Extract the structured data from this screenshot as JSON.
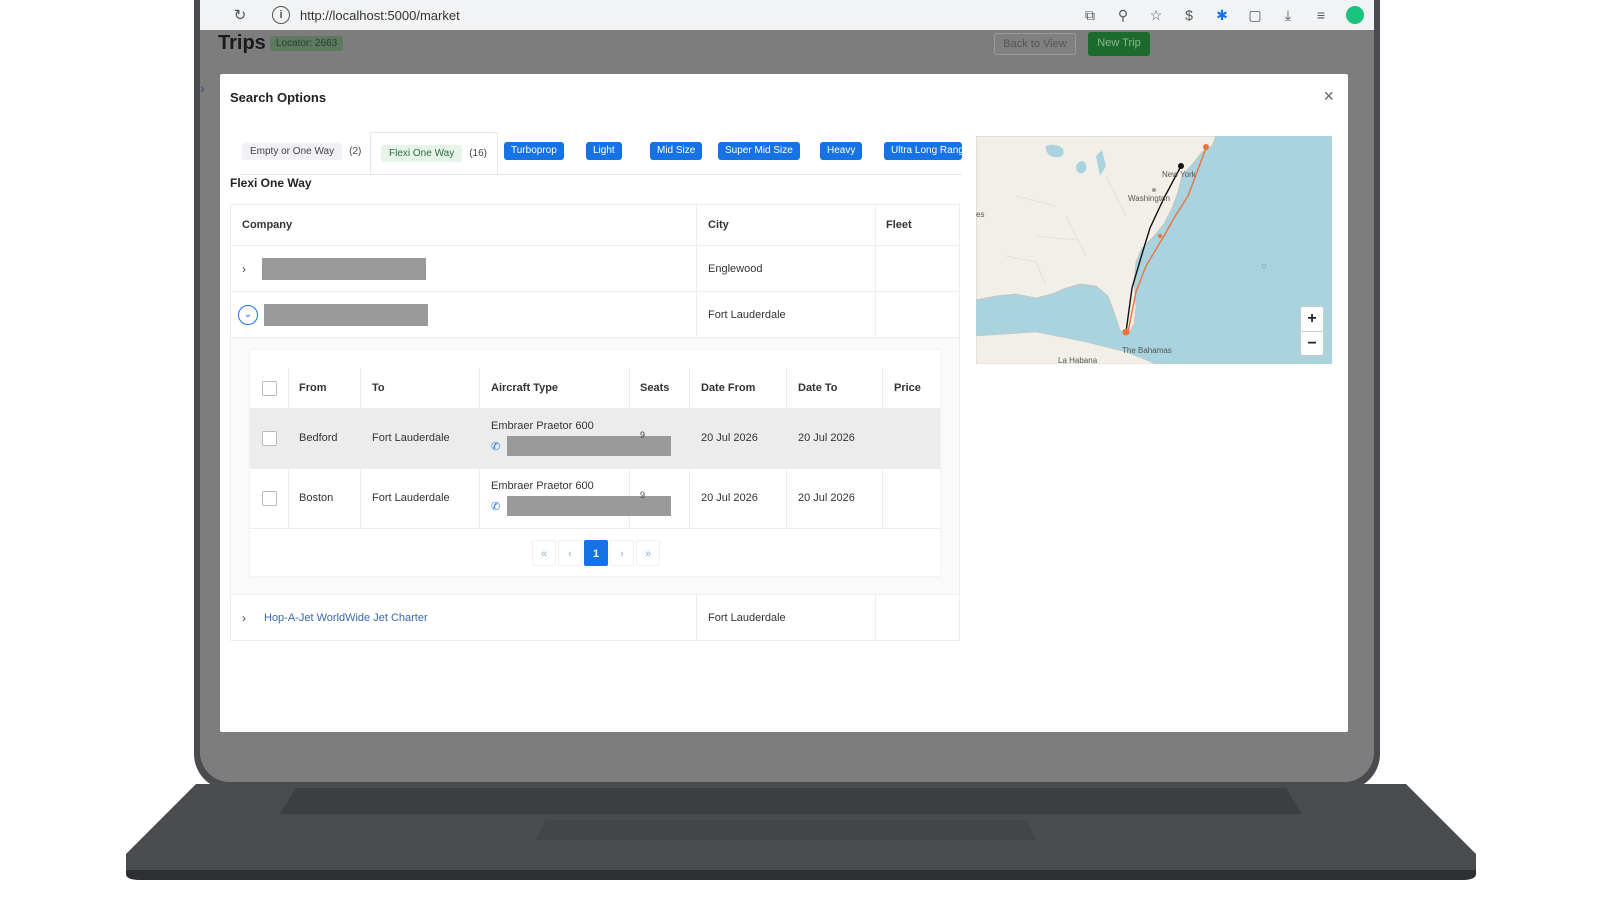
{
  "browser": {
    "url": "http://localhost:5000/market",
    "reload_icon": "reload-icon",
    "info_icon": "info-icon"
  },
  "app": {
    "title": "Trips",
    "locator": "Locator: 2663",
    "back_button": "Back to View",
    "new_trip_button": "New Trip"
  },
  "modal": {
    "title": "Search Options",
    "close_label": "×",
    "section_title": "Flexi One Way"
  },
  "tabs": [
    {
      "label": "Empty or One Way",
      "count": "(2)"
    },
    {
      "label": "Flexi One Way",
      "count": "(16)"
    }
  ],
  "filters": [
    "Turboprop",
    "Light",
    "Mid Size",
    "Super Mid Size",
    "Heavy",
    "Ultra Long Rang"
  ],
  "company_table": {
    "headers": {
      "company": "Company",
      "city": "City",
      "fleet": "Fleet"
    },
    "rows": [
      {
        "company": "",
        "city": "Englewood",
        "fleet": ""
      },
      {
        "company": "",
        "city": "Fort Lauderdale",
        "fleet": ""
      },
      {
        "company": "Hop-A-Jet WorldWide Jet Charter",
        "city": "Fort Lauderdale",
        "fleet": ""
      }
    ]
  },
  "flights_table": {
    "headers": {
      "from": "From",
      "to": "To",
      "aircraft": "Aircraft Type",
      "seats": "Seats",
      "date_from": "Date From",
      "date_to": "Date To",
      "price": "Price"
    },
    "rows": [
      {
        "from": "Bedford",
        "to": "Fort Lauderdale",
        "aircraft": "Embraer Praetor 600",
        "seats": "9",
        "date_from": "20 Jul 2026",
        "date_to": "20 Jul 2026",
        "price": ""
      },
      {
        "from": "Boston",
        "to": "Fort Lauderdale",
        "aircraft": "Embraer Praetor 600",
        "seats": "9",
        "date_from": "20 Jul 2026",
        "date_to": "20 Jul 2026",
        "price": ""
      }
    ]
  },
  "pagination": {
    "first": "«",
    "prev": "‹",
    "current": "1",
    "next": "›",
    "last": "»"
  },
  "map": {
    "labels": {
      "new_york": "New York",
      "washington": "Washington",
      "bahamas": "The Bahamas",
      "havana": "La Habana",
      "partial": "es"
    },
    "zoom_in": "+",
    "zoom_out": "−",
    "route_colors": {
      "route_a": "#111111",
      "route_b": "#e8753b"
    }
  },
  "colors": {
    "accent": "#1673e6",
    "success": "#1d6a2e"
  }
}
